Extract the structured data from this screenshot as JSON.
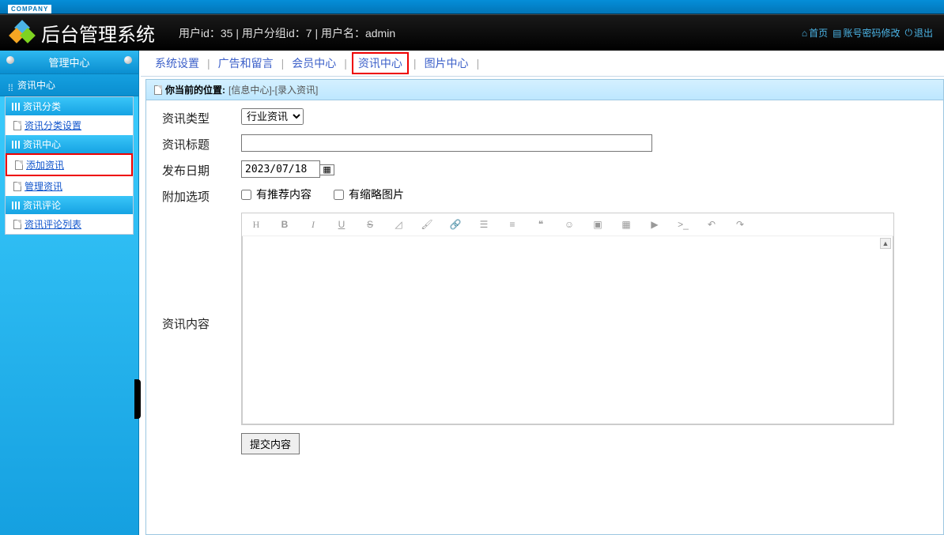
{
  "banner": {
    "company": "COMPANY"
  },
  "header": {
    "title": "后台管理系统",
    "info": "用户id：35 | 用户分组id：7 | 用户名：admin",
    "links": {
      "home": "首页",
      "pwd": "账号密码修改",
      "logout": "退出"
    }
  },
  "sidebar": {
    "topTab": "管理中心",
    "sectionTitle": "资讯中心",
    "groups": [
      {
        "head": "资讯分类",
        "items": [
          {
            "label": "资讯分类设置",
            "hl": false
          }
        ]
      },
      {
        "head": "资讯中心",
        "items": [
          {
            "label": "添加资讯",
            "hl": true
          },
          {
            "label": "管理资讯",
            "hl": false
          }
        ]
      },
      {
        "head": "资讯评论",
        "items": [
          {
            "label": "资讯评论列表",
            "hl": false
          }
        ]
      }
    ]
  },
  "topnav": {
    "items": [
      "系统设置",
      "广告和留言",
      "会员中心",
      "资讯中心",
      "图片中心"
    ],
    "selectedIndex": 3
  },
  "breadcrumb": {
    "label": "你当前的位置:",
    "path": "[信息中心]-[录入资讯]"
  },
  "form": {
    "type": {
      "label": "资讯类型",
      "options": [
        "行业资讯"
      ],
      "value": "行业资讯"
    },
    "title": {
      "label": "资讯标题",
      "value": ""
    },
    "date": {
      "label": "发布日期",
      "value": "2023/07/18"
    },
    "extras": {
      "label": "附加选项",
      "recommend": "有推荐内容",
      "thumb": "有缩略图片"
    },
    "content": {
      "label": "资讯内容"
    },
    "submit": "提交内容"
  }
}
